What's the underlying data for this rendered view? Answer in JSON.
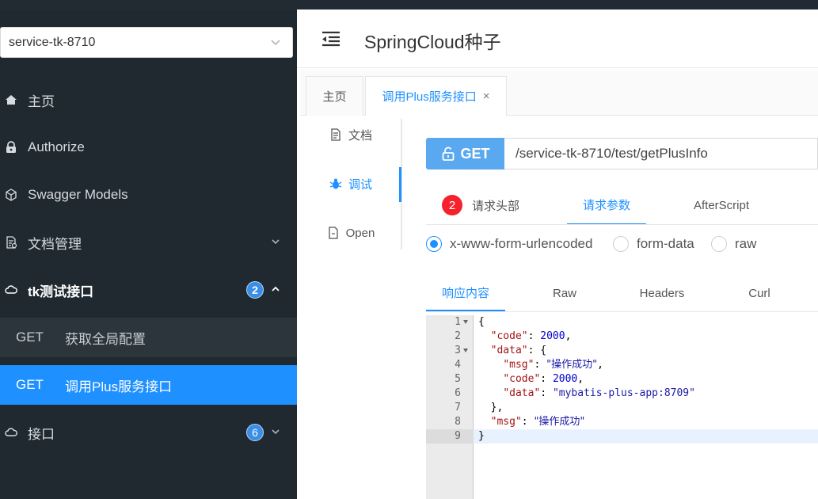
{
  "sidebar": {
    "service_select": "service-tk-8710",
    "items": [
      {
        "label": "主页"
      },
      {
        "label": "Authorize"
      },
      {
        "label": "Swagger Models"
      },
      {
        "label": "文档管理"
      },
      {
        "label": "tk测试接口",
        "badge": "2"
      },
      {
        "label": "接口",
        "badge": "6"
      }
    ],
    "sub_items": [
      {
        "method": "GET",
        "label": "获取全局配置"
      },
      {
        "method": "GET",
        "label": "调用Plus服务接口"
      }
    ]
  },
  "header": {
    "title": "SpringCloud种子"
  },
  "tabs": [
    {
      "label": "主页"
    },
    {
      "label": "调用Plus服务接口",
      "close": "×"
    }
  ],
  "vtabs": [
    {
      "label": "文档"
    },
    {
      "label": "调试"
    },
    {
      "label": "Open"
    }
  ],
  "request": {
    "method": "GET",
    "url": "/service-tk-8710/test/getPlusInfo",
    "tabs": [
      {
        "label": "请求头部",
        "badge": "2"
      },
      {
        "label": "请求参数"
      },
      {
        "label": "AfterScript"
      }
    ],
    "body_types": [
      {
        "label": "x-www-form-urlencoded",
        "selected": true
      },
      {
        "label": "form-data",
        "selected": false
      },
      {
        "label": "raw",
        "selected": false
      }
    ]
  },
  "response": {
    "tabs": [
      {
        "label": "响应内容"
      },
      {
        "label": "Raw"
      },
      {
        "label": "Headers"
      },
      {
        "label": "Curl"
      }
    ],
    "line_numbers": [
      "1",
      "2",
      "3",
      "4",
      "5",
      "6",
      "7",
      "8",
      "9"
    ],
    "json": {
      "k_code": "\"code\"",
      "v_code": "2000",
      "k_data": "\"data\"",
      "k_msg_inner": "\"msg\"",
      "v_msg_inner": "\"操作成功\"",
      "k_code_inner": "\"code\"",
      "v_code_inner": "2000",
      "k_data_inner": "\"data\"",
      "v_data_inner": "\"mybatis-plus-app:8709\"",
      "k_msg": "\"msg\"",
      "v_msg": "\"操作成功\""
    }
  },
  "colors": {
    "accent": "#1e90ff",
    "sidebar_bg": "#20292f",
    "badge_red": "#f5222d"
  }
}
